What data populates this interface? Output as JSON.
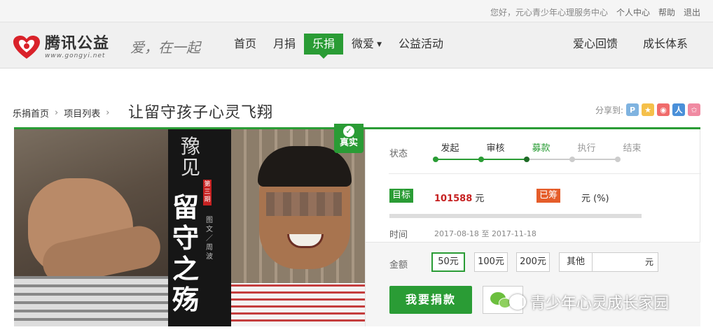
{
  "topbar": {
    "greeting": "您好，元心青少年心理服务中心",
    "links": [
      "个人中心",
      "帮助",
      "退出"
    ]
  },
  "logo": {
    "name": "腾讯公益",
    "url": "www.gongyi.net",
    "slogan": "爱，在一起"
  },
  "nav": {
    "items": [
      {
        "label": "首页",
        "active": false
      },
      {
        "label": "月捐",
        "active": false
      },
      {
        "label": "乐捐",
        "active": true
      },
      {
        "label": "微爱",
        "active": false,
        "dropdown": true
      },
      {
        "label": "公益活动",
        "active": false
      }
    ],
    "right": [
      "爱心回馈",
      "成长体系"
    ]
  },
  "breadcrumb": {
    "items": [
      "乐捐首页",
      "项目列表"
    ]
  },
  "title": "让留守孩子心灵飞翔",
  "share": {
    "label": "分享到:",
    "icons": [
      "qzone-icon",
      "star-icon",
      "weibo-icon",
      "renren-icon",
      "favorite-icon"
    ]
  },
  "photo": {
    "band_title": "豫见",
    "issue": "第三期",
    "headline": "留守之殇",
    "credit": "图文／周波"
  },
  "badge": {
    "label": "真实"
  },
  "status": {
    "label": "状态",
    "steps": [
      {
        "name": "发起",
        "state": "done"
      },
      {
        "name": "审核",
        "state": "done"
      },
      {
        "name": "募款",
        "state": "current"
      },
      {
        "name": "执行",
        "state": "pending"
      },
      {
        "name": "结束",
        "state": "pending"
      }
    ]
  },
  "target": {
    "label": "目标",
    "amount": "101588",
    "unit": "元"
  },
  "raised": {
    "label": "已筹",
    "text": "元 (%)"
  },
  "progress": {
    "percent": 0
  },
  "time": {
    "label": "时间",
    "start": "2017-08-18",
    "to": "至",
    "end": "2017-11-18"
  },
  "amount": {
    "label": "金额",
    "options": [
      "50元",
      "100元",
      "200元",
      "其他"
    ],
    "selected": "50元",
    "other_unit": "元"
  },
  "donate_button": "我要捐款",
  "watermark": "青少年心灵成长家园",
  "colors": {
    "accent": "#2a9c35",
    "raised_tag": "#e55d2a",
    "target_amount": "#c62121"
  }
}
